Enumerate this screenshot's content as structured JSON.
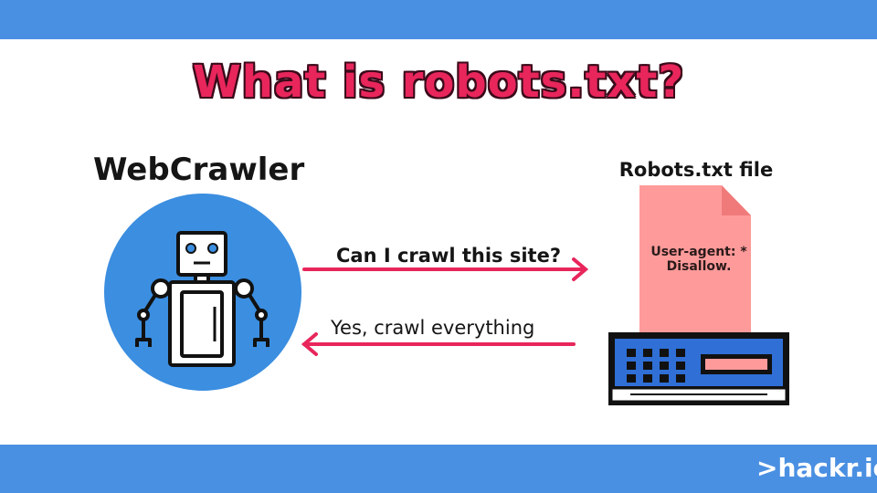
{
  "title": "What is robots.txt?",
  "crawler": {
    "label": "WebCrawler"
  },
  "file": {
    "label": "Robots.txt file",
    "lines": [
      "User-agent: *",
      "Disallow."
    ]
  },
  "messages": {
    "request": "Can I crawl this site?",
    "response": "Yes, crawl everything"
  },
  "brand": {
    "text": ">hackr.io"
  },
  "colors": {
    "band": "#4a90e2",
    "accent": "#e8265c",
    "arrow": "#e8265c",
    "circle": "#3b8ee0",
    "file": "#ff9a9a",
    "server": "#2f6fd6"
  }
}
